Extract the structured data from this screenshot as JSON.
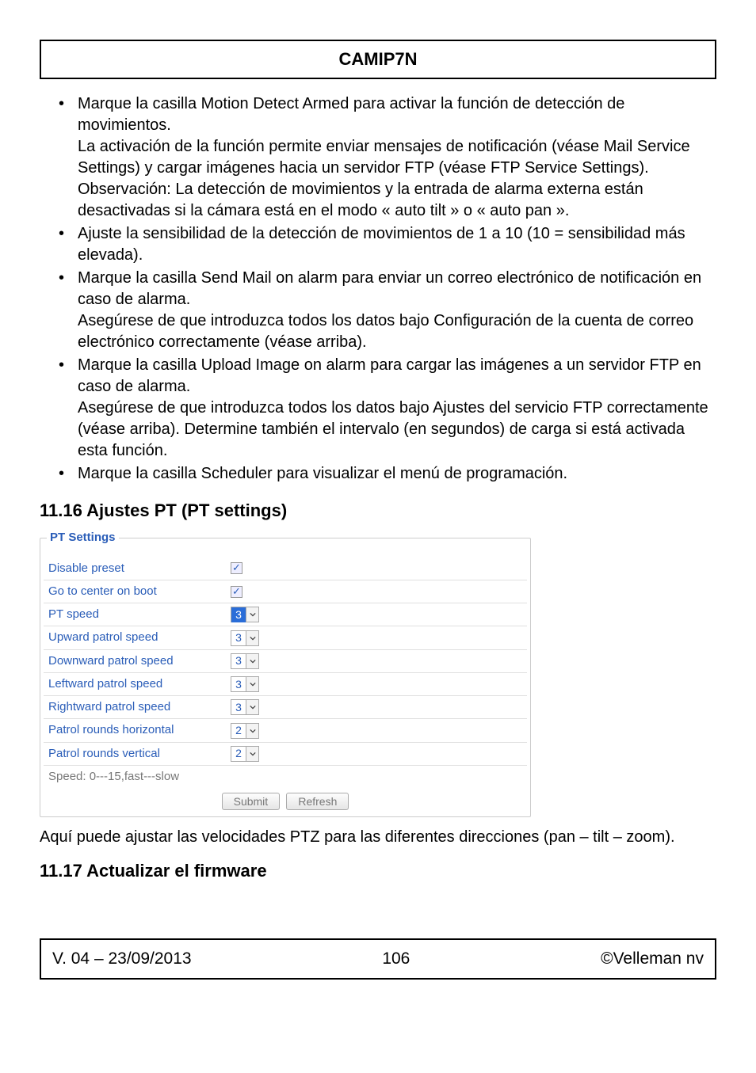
{
  "header": {
    "title": "CAMIP7N"
  },
  "bullets": [
    "Marque la casilla Motion Detect Armed para activar la función de detección de movimientos.\nLa activación de la función permite enviar mensajes de notificación (véase Mail Service Settings) y cargar imágenes hacia un servidor FTP (véase FTP Service Settings).\nObservación: La detección de movimientos y la entrada de alarma externa están desactivadas si la cámara está en el modo « auto tilt » o « auto pan ».",
    "Ajuste la sensibilidad de la detección de movimientos de 1 a 10 (10 = sensibilidad más elevada).",
    "Marque la casilla Send Mail on alarm para enviar un correo electrónico de notificación en caso de alarma.\nAsegúrese de que introduzca todos los datos bajo Configuración de la cuenta de correo electrónico correctamente (véase arriba).",
    "Marque la casilla Upload Image on alarm para cargar las imágenes a un servidor FTP en caso de alarma.\nAsegúrese de que introduzca todos los datos bajo Ajustes del servicio FTP correctamente (véase arriba). Determine también el intervalo (en segundos) de carga si está activada esta función.",
    "Marque la casilla Scheduler para visualizar el menú de programación."
  ],
  "section_11_16": {
    "title": "11.16 Ajustes PT (PT settings)"
  },
  "pt_settings": {
    "legend": "PT Settings",
    "rows": [
      {
        "label": "Disable preset",
        "type": "checkbox",
        "checked": true
      },
      {
        "label": "Go to center on boot",
        "type": "checkbox",
        "checked": true
      },
      {
        "label": "PT speed",
        "type": "select",
        "value": "3",
        "highlight": true
      },
      {
        "label": "Upward patrol speed",
        "type": "select",
        "value": "3"
      },
      {
        "label": "Downward patrol speed",
        "type": "select",
        "value": "3"
      },
      {
        "label": "Leftward patrol speed",
        "type": "select",
        "value": "3"
      },
      {
        "label": "Rightward patrol speed",
        "type": "select",
        "value": "3"
      },
      {
        "label": "Patrol rounds horizontal",
        "type": "select",
        "value": "2"
      },
      {
        "label": "Patrol rounds vertical",
        "type": "select",
        "value": "2"
      }
    ],
    "note": "Speed: 0---15,fast---slow",
    "submit": "Submit",
    "refresh": "Refresh"
  },
  "after_pt_text": "Aquí puede ajustar las velocidades PTZ para las diferentes direcciones (pan – tilt – zoom).",
  "section_11_17": {
    "title": "11.17 Actualizar el firmware"
  },
  "footer": {
    "left": "V. 04 – 23/09/2013",
    "center": "106",
    "right": "©Velleman nv"
  }
}
